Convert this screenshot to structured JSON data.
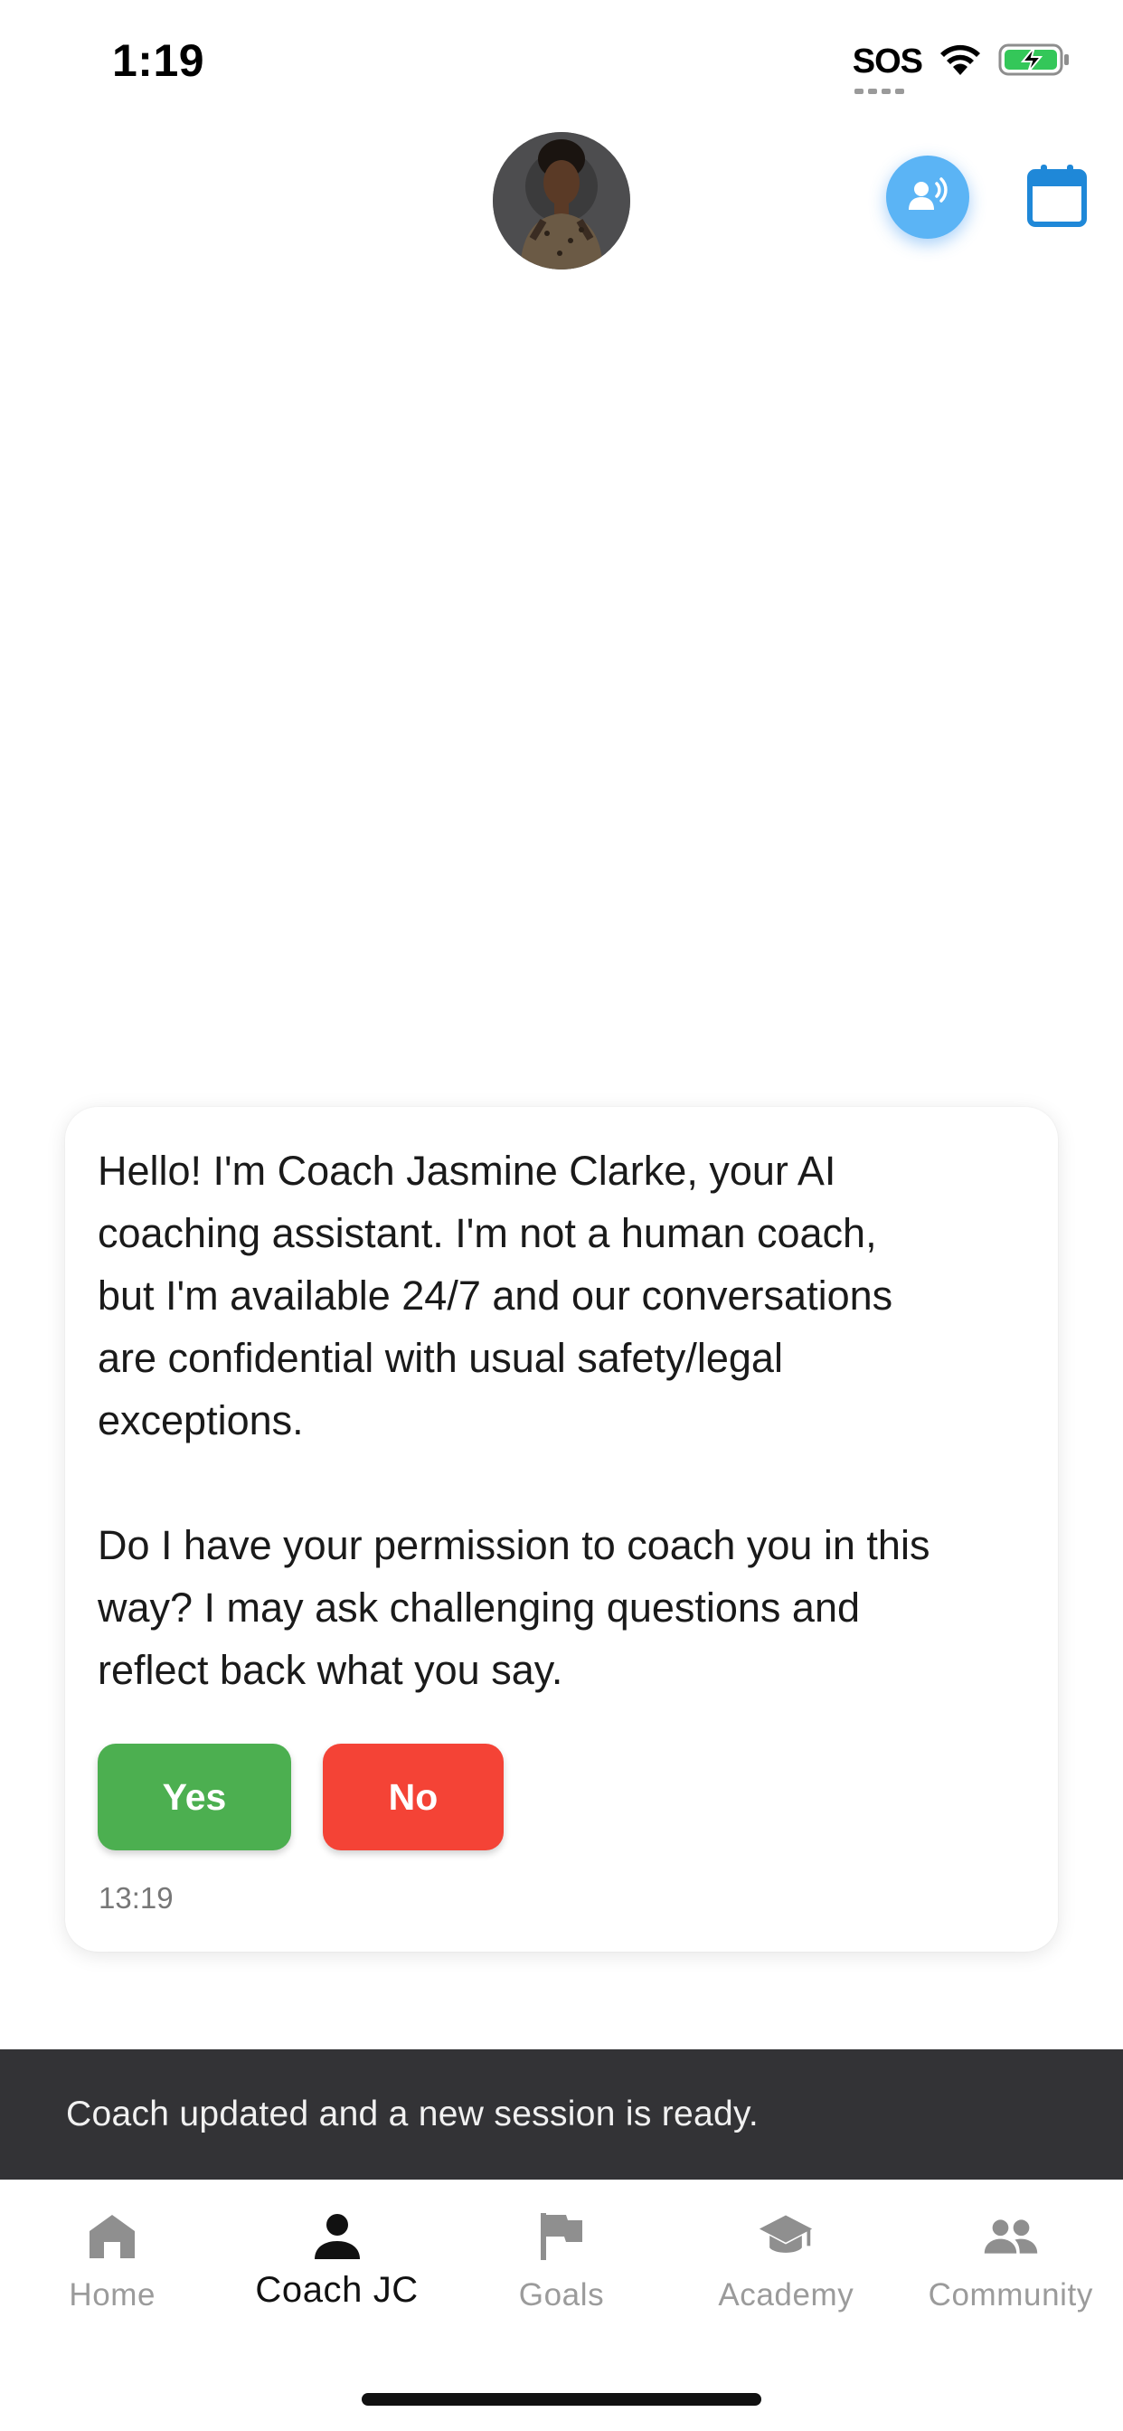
{
  "status_bar": {
    "time": "1:19",
    "sos_label": "SOS",
    "icons": [
      "wifi-icon",
      "battery-charging-icon"
    ]
  },
  "header": {
    "avatar_alt": "Coach Jasmine Clarke avatar",
    "voice_icon": "voice-chat-icon",
    "calendar_icon": "calendar-icon",
    "accent_color": "#5bb4f5",
    "calendar_color": "#1f88d8"
  },
  "message": {
    "text": "Hello! I'm Coach Jasmine Clarke, your AI\ncoaching assistant. I'm not a human coach,\nbut I'm available 24/7 and our conversations\nare confidential with usual safety/legal\nexceptions.\n\nDo I have your permission to coach you in this\nway? I may ask challenging questions and\nreflect back what you say.",
    "yes_label": "Yes",
    "no_label": "No",
    "yes_color": "#4caf50",
    "no_color": "#f44336",
    "timestamp": "13:19"
  },
  "snackbar": {
    "text": "Coach updated and a new session is ready."
  },
  "bottom_nav": {
    "items": [
      {
        "label": "Home",
        "icon": "home-icon",
        "active": false
      },
      {
        "label": "Coach JC",
        "icon": "person-icon",
        "active": true
      },
      {
        "label": "Goals",
        "icon": "flag-icon",
        "active": false
      },
      {
        "label": "Academy",
        "icon": "graduation-cap-icon",
        "active": false
      },
      {
        "label": "Community",
        "icon": "people-icon",
        "active": false
      }
    ]
  }
}
